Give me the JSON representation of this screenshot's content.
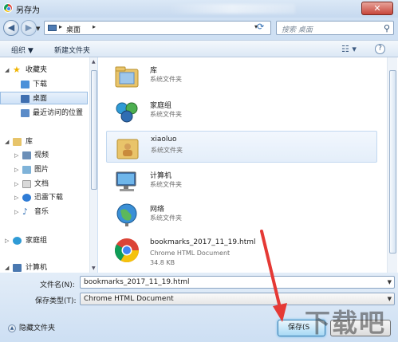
{
  "window": {
    "title": "另存为",
    "close_glyph": "✕"
  },
  "navbar": {
    "back_glyph": "◀",
    "forward_glyph": "▶",
    "address": [
      "桌面"
    ],
    "search_placeholder": "搜索 桌面",
    "refresh_glyph": "⟳",
    "search_glyph": "⚲"
  },
  "toolbar": {
    "organize": "组织 ▼",
    "new_folder": "新建文件夹",
    "view_glyph": "☷ ▾",
    "help_glyph": "?"
  },
  "sidebar": {
    "items": [
      {
        "label": "收藏夹",
        "icon": "star-icon",
        "color": "#f0b400"
      },
      {
        "label": "下载",
        "icon": "download-folder-icon",
        "color": "#4a90d9"
      },
      {
        "label": "桌面",
        "icon": "desktop-icon",
        "color": "#3f6fb0",
        "selected": true
      },
      {
        "label": "最近访问的位置",
        "icon": "recent-places-icon",
        "color": "#5a8bc8"
      },
      {
        "label": "库",
        "icon": "library-icon",
        "color": "#e7c46a"
      },
      {
        "label": "视频",
        "icon": "video-library-icon",
        "color": "#6b8fb8"
      },
      {
        "label": "图片",
        "icon": "pictures-library-icon",
        "color": "#7fb3d9"
      },
      {
        "label": "文档",
        "icon": "documents-library-icon",
        "color": "#d9d9d9"
      },
      {
        "label": "迅雷下载",
        "icon": "thunder-download-icon",
        "color": "#2f7cd6"
      },
      {
        "label": "音乐",
        "icon": "music-library-icon",
        "color": "#3a76b8"
      },
      {
        "label": "家庭组",
        "icon": "homegroup-icon",
        "color": "#2f9bd6"
      },
      {
        "label": "计算机",
        "icon": "computer-icon",
        "color": "#4a78b0"
      }
    ]
  },
  "files": {
    "items": [
      {
        "name": "库",
        "type": "系统文件夹",
        "icon": "library-folder-icon"
      },
      {
        "name": "家庭组",
        "type": "系统文件夹",
        "icon": "homegroup-icon"
      },
      {
        "name": "xiaoluo",
        "type": "系统文件夹",
        "icon": "user-folder-icon",
        "highlighted": true
      },
      {
        "name": "计算机",
        "type": "系统文件夹",
        "icon": "computer-icon"
      },
      {
        "name": "网络",
        "type": "系统文件夹",
        "icon": "network-icon"
      },
      {
        "name": "bookmarks_2017_11_19.html",
        "type": "Chrome HTML Document",
        "size": "34.8 KB",
        "icon": "chrome-icon"
      }
    ]
  },
  "form": {
    "filename_label": "文件名(N):",
    "filename_value": "bookmarks_2017_11_19.html",
    "filetype_label": "保存类型(T):",
    "filetype_value": "Chrome HTML Document",
    "hide_folders": "隐藏文件夹",
    "save_button": "保存(S",
    "cancel_button": ""
  },
  "watermark": "下载吧",
  "colors": {
    "accent": "#3c7fb1",
    "arrow": "#e53935",
    "selection": "#cfe2f7"
  }
}
